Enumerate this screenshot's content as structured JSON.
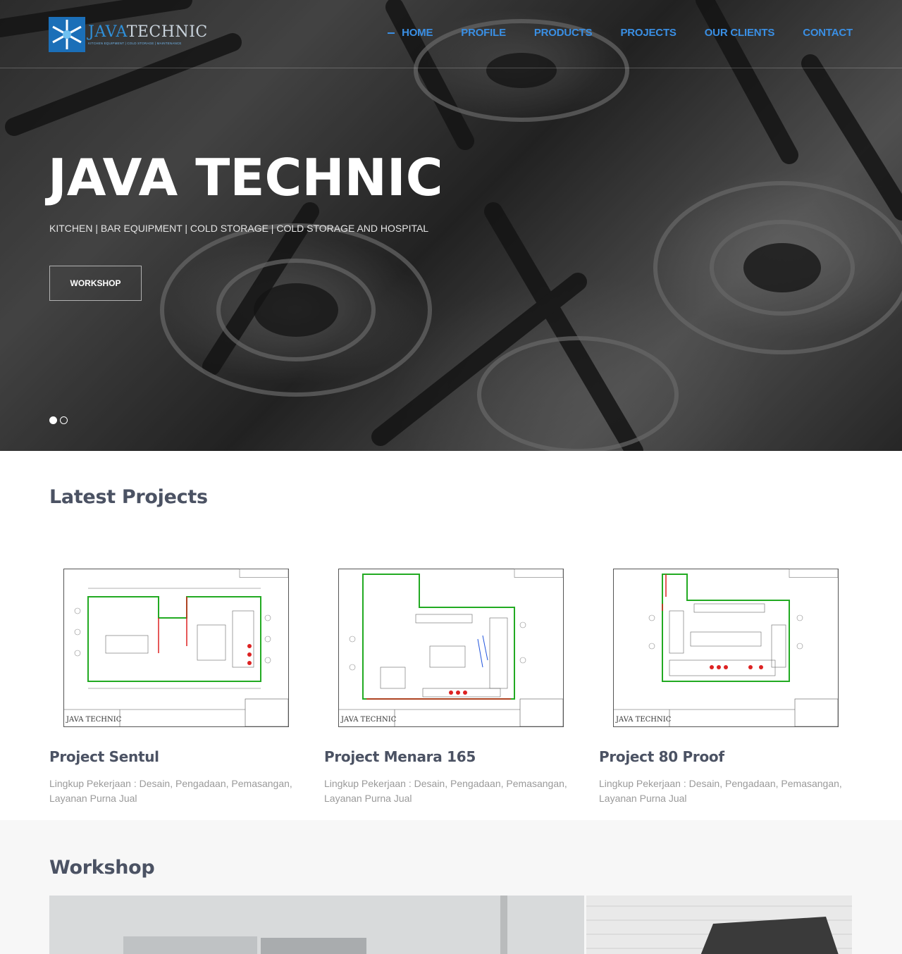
{
  "header": {
    "logo": {
      "word_a": "JAVA",
      "word_b": "TECHNIC",
      "tagline": "KITCHEN EQUIPMENT | COLD STORAGE | MAINTENANCE"
    },
    "nav": [
      {
        "label": "HOME",
        "active": true
      },
      {
        "label": "PROFILE",
        "active": false
      },
      {
        "label": "PRODUCTS",
        "active": false
      },
      {
        "label": "PROJECTS",
        "active": false
      },
      {
        "label": "OUR CLIENTS",
        "active": false
      },
      {
        "label": "CONTACT",
        "active": false
      }
    ]
  },
  "hero": {
    "title": "JAVA TECHNIC",
    "subtitle": "KITCHEN | BAR EQUIPMENT | COLD STORAGE | COLD STORAGE AND HOSPITAL",
    "button_label": "WORKSHOP",
    "slides_total": 2,
    "slide_active": 1
  },
  "latest_projects": {
    "title": "Latest Projects",
    "items": [
      {
        "name": "Project Sentul",
        "description": "Lingkup Pekerjaan : Desain, Pengadaan, Pemasangan, Layanan Purna Jual",
        "drawing_label": "JAVA TECHNIC"
      },
      {
        "name": "Project Menara 165",
        "description": "Lingkup Pekerjaan : Desain, Pengadaan, Pemasangan, Layanan Purna Jual",
        "drawing_label": "JAVA TECHNIC"
      },
      {
        "name": "Project 80 Proof",
        "description": "Lingkup Pekerjaan : Desain, Pengadaan, Pemasangan, Layanan Purna Jual",
        "drawing_label": "JAVA TECHNIC"
      }
    ]
  },
  "workshop": {
    "title": "Workshop"
  },
  "colors": {
    "accent": "#3a8fe4",
    "heading": "#4b5263",
    "muted": "#9a9a9a"
  }
}
